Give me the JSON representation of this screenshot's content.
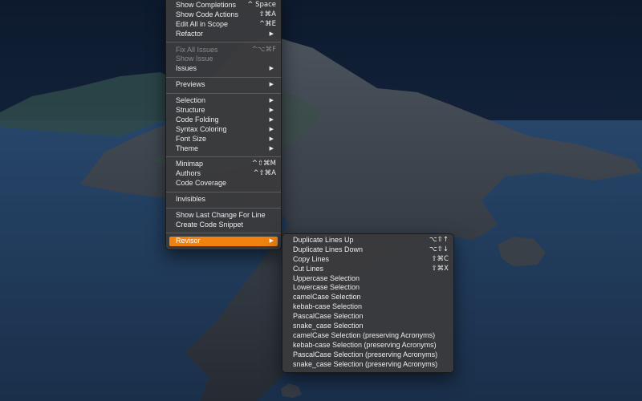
{
  "menu": {
    "groups": [
      [
        {
          "label": "Show Completions",
          "shortcut": "^ Space"
        },
        {
          "label": "Show Code Actions",
          "shortcut": "⇧⌘A"
        },
        {
          "label": "Edit All in Scope",
          "shortcut": "^⌘E"
        },
        {
          "label": "Refactor",
          "submenu": true,
          "arrow": "▶"
        }
      ],
      [
        {
          "label": "Fix All Issues",
          "shortcut": "^⌥⌘F",
          "disabled": true
        },
        {
          "label": "Show Issue",
          "disabled": true
        },
        {
          "label": "Issues",
          "submenu": true,
          "arrow": "▶"
        }
      ],
      [
        {
          "label": "Previews",
          "submenu": true,
          "arrow": "▶"
        }
      ],
      [
        {
          "label": "Selection",
          "submenu": true,
          "arrow": "▶"
        },
        {
          "label": "Structure",
          "submenu": true,
          "arrow": "▶"
        },
        {
          "label": "Code Folding",
          "submenu": true,
          "arrow": "▶"
        },
        {
          "label": "Syntax Coloring",
          "submenu": true,
          "arrow": "▶"
        },
        {
          "label": "Font Size",
          "submenu": true,
          "arrow": "▶"
        },
        {
          "label": "Theme",
          "submenu": true,
          "arrow": "▶"
        }
      ],
      [
        {
          "label": "Minimap",
          "shortcut": "^⇧⌘M"
        },
        {
          "label": "Authors",
          "shortcut": "^⇧⌘A"
        },
        {
          "label": "Code Coverage"
        }
      ],
      [
        {
          "label": "Invisibles"
        }
      ],
      [
        {
          "label": "Show Last Change For Line"
        },
        {
          "label": "Create Code Snippet"
        }
      ],
      [
        {
          "label": "Revisor",
          "submenu": true,
          "arrow": "▶",
          "selected": true
        }
      ]
    ]
  },
  "submenu": {
    "items": [
      {
        "label": "Duplicate Lines Up",
        "shortcut": "⌥⇧↑"
      },
      {
        "label": "Duplicate Lines Down",
        "shortcut": "⌥⇧↓"
      },
      {
        "label": "Copy Lines",
        "shortcut": "⇧⌘C"
      },
      {
        "label": "Cut Lines",
        "shortcut": "⇧⌘X"
      },
      {
        "label": "Uppercase Selection"
      },
      {
        "label": "Lowercase Selection"
      },
      {
        "label": "camelCase Selection"
      },
      {
        "label": "kebab-case Selection"
      },
      {
        "label": "PascalCase Selection"
      },
      {
        "label": "snake_case Selection"
      },
      {
        "label": "camelCase Selection (preserving Acronyms)"
      },
      {
        "label": "kebab-case Selection (preserving Acronyms)"
      },
      {
        "label": "PascalCase Selection (preserving Acronyms)"
      },
      {
        "label": "snake_case Selection (preserving Acronyms)"
      }
    ]
  },
  "colors": {
    "menu_bg": "#3a3a3c",
    "highlight": "#f1820f",
    "text": "#ececec",
    "disabled_text": "#8a8a8c",
    "sea": "#1f3550",
    "sky": "#0f1d33"
  }
}
